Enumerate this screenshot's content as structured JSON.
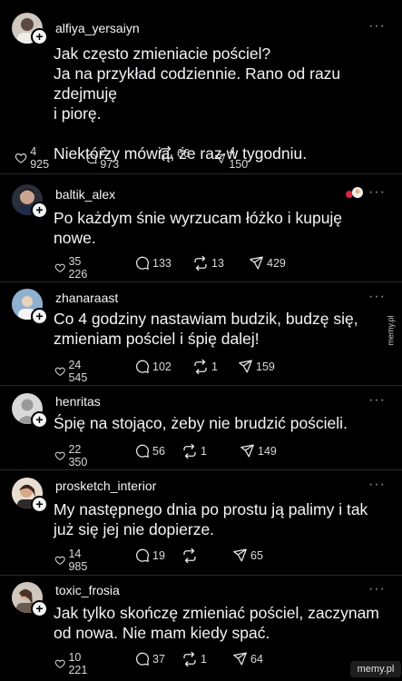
{
  "posts": [
    {
      "username": "alfiya_yersaiyn",
      "text_lines": [
        "Jak często zmieniacie pościel?",
        "Ja na przykład codziennie. Rano od razu zdejmuję",
        "i piorę.",
        "",
        "Niektórzy mówią, że raz w tygodniu."
      ],
      "likes": "4 925",
      "comments": "2 973",
      "reposts": "66",
      "shares": "4 150",
      "avatar_color": "#cfc7c0"
    },
    {
      "username": "baltik_alex",
      "text_lines": [
        "Po każdym śnie wyrzucam łóżko i kupuję",
        "nowe."
      ],
      "likes": "35 226",
      "comments": "133",
      "reposts": "13",
      "shares": "429",
      "avatar_color": "#2b2f3a"
    },
    {
      "username": "zhanaraast",
      "text_lines": [
        "Co 4 godziny nastawiam budzik, budzę się,",
        "zmieniam pościel i śpię dalej!"
      ],
      "likes": "24 545",
      "comments": "102",
      "reposts": "1",
      "shares": "159",
      "avatar_color": "#6c8fb3"
    },
    {
      "username": "henritas",
      "text_lines": [
        "Śpię na stojąco, żeby nie brudzić pościeli."
      ],
      "likes": "22 350",
      "comments": "56",
      "reposts": "1",
      "shares": "149",
      "avatar_color": "#d9d9d9"
    },
    {
      "username": "prosketch_interior",
      "text_lines": [
        "My następnego dnia po prostu ją palimy i tak",
        "już się jej nie dopierze."
      ],
      "likes": "14 985",
      "comments": "19",
      "reposts": "",
      "shares": "65",
      "avatar_color": "#b88a6a"
    },
    {
      "username": "toxic_frosia",
      "text_lines": [
        "Jak tylko skończę zmieniać pościel, zaczynam",
        "od nowa. Nie mam kiedy spać."
      ],
      "likes": "10 221",
      "comments": "37",
      "reposts": "1",
      "shares": "64",
      "avatar_color": "#9b8f86"
    }
  ],
  "more_label": "···",
  "plus_label": "+",
  "watermark_side": "memy.pl",
  "watermark_bottom": "memy.pl"
}
